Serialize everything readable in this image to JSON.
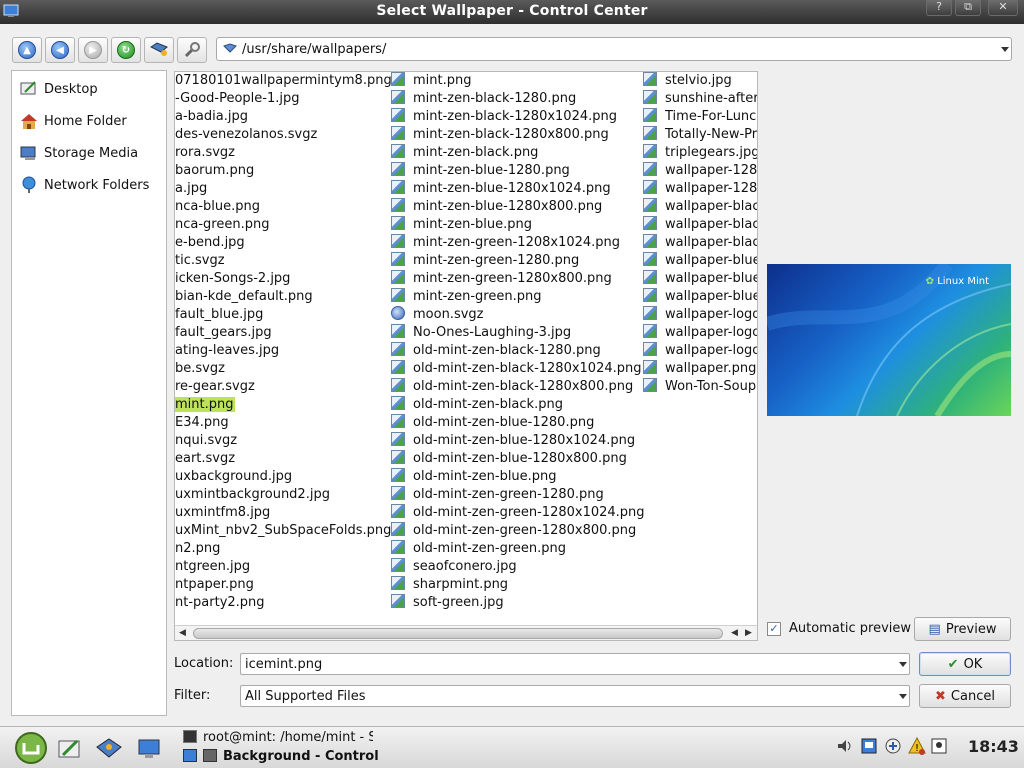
{
  "window": {
    "title": "Select Wallpaper - Control Center"
  },
  "titlebar_buttons": [
    "?",
    "⧉",
    "✕"
  ],
  "toolbar": {
    "buttons": [
      "up-icon",
      "back-icon",
      "forward-icon",
      "reload-icon",
      "new-folder-icon",
      "options-icon"
    ],
    "path": "/usr/share/wallpapers/"
  },
  "sidebar": {
    "items": [
      {
        "label": "Desktop",
        "icon": "desktop-icon"
      },
      {
        "label": "Home Folder",
        "icon": "home-icon"
      },
      {
        "label": "Storage Media",
        "icon": "storage-icon"
      },
      {
        "label": "Network Folders",
        "icon": "network-icon"
      }
    ]
  },
  "files": {
    "col1": [
      "07180101wallpapermintym8.png",
      "-Good-People-1.jpg",
      "a-badia.jpg",
      "des-venezolanos.svgz",
      "rora.svgz",
      "baorum.png",
      "a.jpg",
      "nca-blue.png",
      "nca-green.png",
      "e-bend.jpg",
      "tic.svgz",
      "icken-Songs-2.jpg",
      "bian-kde_default.png",
      "fault_blue.jpg",
      "fault_gears.jpg",
      "ating-leaves.jpg",
      "be.svgz",
      "re-gear.svgz",
      "mint.png",
      "E34.png",
      "nqui.svgz",
      "eart.svgz",
      "uxbackground.jpg",
      "uxmintbackground2.jpg",
      "uxmintfm8.jpg",
      "uxMint_nbv2_SubSpaceFolds.png",
      "n2.png",
      "ntgreen.jpg",
      "ntpaper.png",
      "nt-party2.png"
    ],
    "col2": [
      "mint.png",
      "mint-zen-black-1280.png",
      "mint-zen-black-1280x1024.png",
      "mint-zen-black-1280x800.png",
      "mint-zen-black.png",
      "mint-zen-blue-1280.png",
      "mint-zen-blue-1280x1024.png",
      "mint-zen-blue-1280x800.png",
      "mint-zen-blue.png",
      "mint-zen-green-1208x1024.png",
      "mint-zen-green-1280.png",
      "mint-zen-green-1280x800.png",
      "mint-zen-green.png",
      "moon.svgz",
      "No-Ones-Laughing-3.jpg",
      "old-mint-zen-black-1280.png",
      "old-mint-zen-black-1280x1024.png",
      "old-mint-zen-black-1280x800.png",
      "old-mint-zen-black.png",
      "old-mint-zen-blue-1280.png",
      "old-mint-zen-blue-1280x1024.png",
      "old-mint-zen-blue-1280x800.png",
      "old-mint-zen-blue.png",
      "old-mint-zen-green-1280.png",
      "old-mint-zen-green-1280x1024.png",
      "old-mint-zen-green-1280x800.png",
      "old-mint-zen-green.png",
      "seaofconero.jpg",
      "sharpmint.png",
      "soft-green.jpg"
    ],
    "col3": [
      "stelvio.jpg",
      "sunshine-after",
      "Time-For-Lunc",
      "Totally-New-Pr",
      "triplegears.jpg",
      "wallpaper-1280",
      "wallpaper-1280",
      "wallpaper-blac",
      "wallpaper-blac",
      "wallpaper-blac",
      "wallpaper-blue",
      "wallpaper-blue",
      "wallpaper-blue",
      "wallpaper-logo",
      "wallpaper-logo",
      "wallpaper-logo",
      "wallpaper.png",
      "Won-Ton-Soup"
    ],
    "selected": "mint.png"
  },
  "preview": {
    "logo_text": "Linux Mint",
    "auto_label": "Automatic preview",
    "auto_checked": true,
    "button": "Preview"
  },
  "location": {
    "label": "Location:",
    "value": "icemint.png"
  },
  "filter": {
    "label": "Filter:",
    "value": "All Supported Files"
  },
  "buttons": {
    "ok": "OK",
    "cancel": "Cancel"
  },
  "taskbar": {
    "tasks": [
      "root@mint: /home/mint - S",
      "Background - Control"
    ],
    "clock": "18:43",
    "tray": [
      "volume-icon",
      "display-icon",
      "network-icon",
      "warning-icon",
      "screenshot-icon"
    ]
  },
  "colors": {
    "selection": "#bde35c",
    "titlebar": "#3a3a3a"
  }
}
